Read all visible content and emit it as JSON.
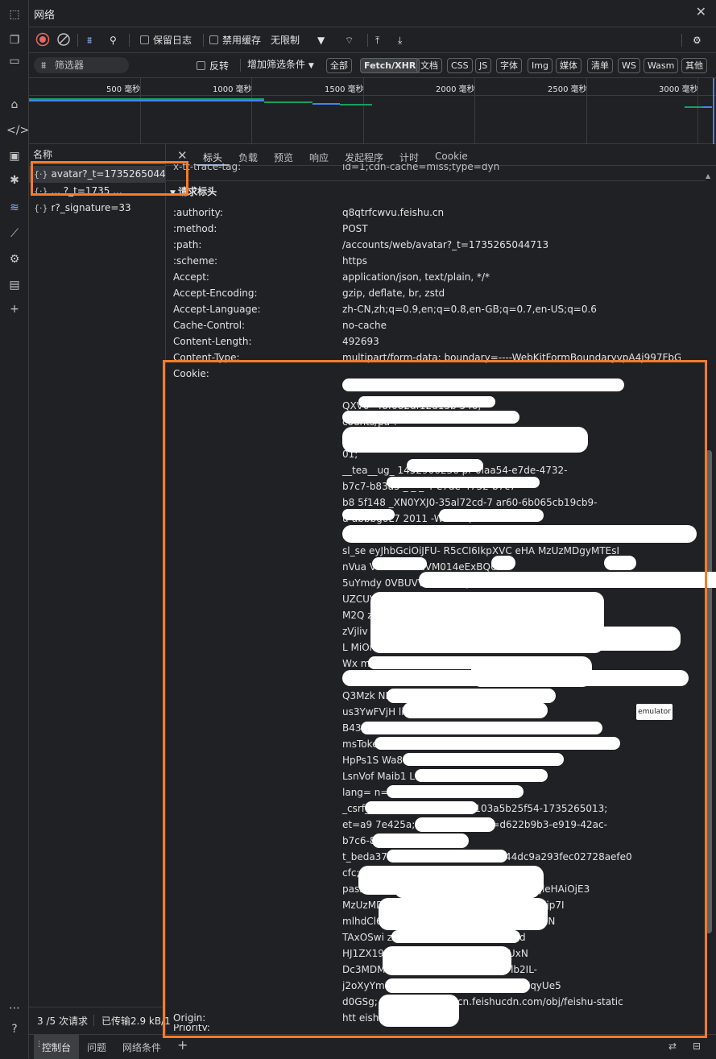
{
  "panel": {
    "title": "网络",
    "close": "✕"
  },
  "toolbar": {
    "preserve_log": "保留日志",
    "disable_cache": "禁用缓存",
    "throttle": "无限制"
  },
  "filter": {
    "placeholder": "筛选器",
    "invert": "反转",
    "more_filters": "增加筛选条件",
    "types": [
      "全部",
      "Fetch/XHR",
      "文档",
      "CSS",
      "JS",
      "字体",
      "Img",
      "媒体",
      "清单",
      "WS",
      "Wasm",
      "其他"
    ],
    "active_type": "Fetch/XHR"
  },
  "overview": {
    "ticks": [
      "500 毫秒",
      "1000 毫秒",
      "1500 毫秒",
      "2000 毫秒",
      "2500 毫秒",
      "3000 毫秒"
    ]
  },
  "requests": {
    "header": "名称",
    "items": [
      {
        "name": "avatar?_t=1735265044713",
        "selected": true
      },
      {
        "name": "... ?_t=1735 ...",
        "selected": false
      },
      {
        "name": "r?_signature=33",
        "selected": false
      }
    ]
  },
  "detail": {
    "tabs": [
      "标头",
      "负载",
      "预览",
      "响应",
      "发起程序",
      "计时",
      "Cookie"
    ],
    "active_tab": "标头",
    "partial_row": "x-tt-trace-tag:",
    "partial_value": "id=1;cdn-cache=miss;type=dyn",
    "section": "请求标头",
    "headers": [
      {
        "k": ":authority:",
        "v": "q8qtrfcwvu.feishu.cn"
      },
      {
        "k": ":method:",
        "v": "POST"
      },
      {
        "k": ":path:",
        "v": "/accounts/web/avatar?_t=1735265044713"
      },
      {
        "k": ":scheme:",
        "v": "https"
      },
      {
        "k": "Accept:",
        "v": "application/json, text/plain, */*"
      },
      {
        "k": "Accept-Encoding:",
        "v": "gzip, deflate, br, zstd"
      },
      {
        "k": "Accept-Language:",
        "v": "zh-CN,zh;q=0.9,en;q=0.8,en-GB;q=0.7,en-US;q=0.6"
      },
      {
        "k": "Cache-Control:",
        "v": "no-cache"
      },
      {
        "k": "Content-Length:",
        "v": "492693"
      },
      {
        "k": "Content-Type:",
        "v": "multipart/form-data; boundary=----WebKitFormBoundaryvpA4j997FbGF97ZHj"
      }
    ],
    "cookie_key": "Cookie:",
    "cookie_lines": [
      "QXV0-                                           48f082df12d15b    546;",
      "                                                          counts/pa           ?",
      "                                                                              (3A%2F%2Fq8qtrfcwv",
      "                                                                                   01;",
      "__tea__ug_          1452906236                    pr           0laa54-e7de-4732-",
      "b7c7-b83a5               _                   _   _          4-e7de-4732-b7c7-",
      "b8  5f148          _XN0YXJ0-35al72cd-7             ar60-6b065cb19cb9-",
      "               u-abbbg0L7                          2011           -WVuZA;",
      "",
      "sl_se          eyJhbGciOiJFU-          R5cCI6IkpXVC         eHA     MzUzMDgyMTEsI",
      "nVua            V9t                                        d3R             XNVM014eExBQU",
      "5uYmdy                                                                    0VBUVVGQlFVRkJ",
      "  UZCUV                              XmR6MDl                            VE0ZWU3Z",
      "      M2Q                           zUxND                                      U2O",
      "        zVjliv                   24iLC                                          MDEx",
      "L        MiOn                                                                   9kljpud",
      "Wx        mYiOnsiar                                           nmMVhPd19MTIlj",
      "c1c0          nZFbyJ9L                                          2MDgyNTkzMjg1OT",
      "Q3Mzk          NF                                        ylslm90ljoxfX0.KUfwQv_",
      "us3YwFVjH                                                      lilYHLqPHGJ         Z1Z",
      "B43zKwTY",
      "msToken                                  gP                     ZCyUZBDXvBAPYHkdvy6",
      "HpPs1S         Wa8v                     C6                  ddU8Mucb3kAotc_nThne1V",
      "LsnVof          Maib1                                     LcvVfFU5zf276FZfg==;",
      "lang=                                                         n=1;",
      "_csrf_     =a5b1                       4220c5a4dde103a5b25f54-1735265013;",
      "et=a9                                7e425a; swp_csrf_token=d622b9b3-e919-42ac-",
      "b7c6-8f9",
      "t_beda37=7ef91                        79c52da0590ad44dc9a293fec02728aefe0",
      "cfc;",
      "passport_             bGc          1NilsInR5cCI6IkpXVCJ9.eyJleHAiOjE3",
      "MzUzMDr                         6eyJtX2FjY2Vzc19pbmZvljp7IjI5ljp7I",
      "mlhdCl6N                        IfSwiMTQzljp7ImlhdCl6MTczNTI2N",
      "TAxOSwi                            zUyNjUwMTEsImFjY2Vzcyl6d",
      "HJ1ZX19L                         M2QwOWIwY2Q3NjkyYzUxN",
      "Dc3MDM3Y                             j3YzVjIn19.cSFVukP24rlb2IL-",
      "j2oXyYmNjm                                  hXsf7oL_rfDy_XBix6DcOXqyUe5",
      "d0GSg;           st=//lf-package-cn.feishucdn.com/obj/feishu-static"
    ],
    "origin_key": "Origin:",
    "origin_value": "htt                        eishu.cn",
    "priority_key": "Priority:",
    "tooltip": "emulator"
  },
  "status": {
    "requests": "3 /5 次请求",
    "transferred": "已传输2.9 kB/1"
  },
  "drawer": {
    "tabs": [
      "控制台",
      "问题",
      "网络条件"
    ],
    "add": "+"
  },
  "colors": {
    "accent": "#f47c2a",
    "record": "#e46962",
    "bg": "#202124"
  }
}
